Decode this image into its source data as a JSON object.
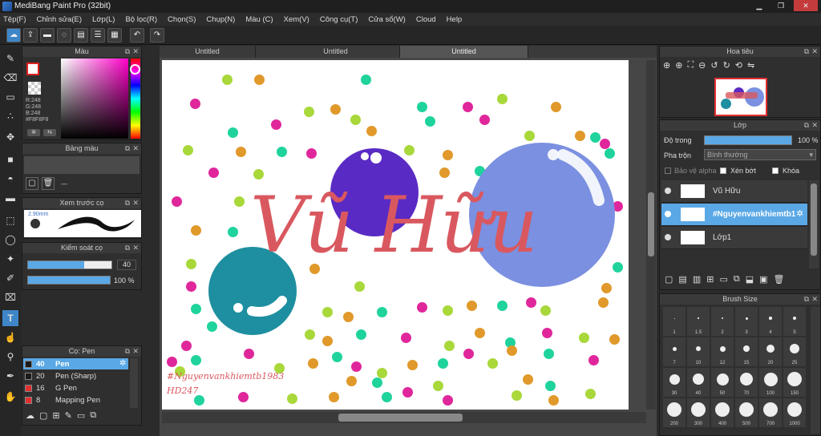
{
  "window": {
    "title": "MediBang Paint Pro (32bit)",
    "minimize": "▁",
    "restore": "❐",
    "close": "✕"
  },
  "menu": [
    "Tệp(F)",
    "Chỉnh sửa(E)",
    "Lớp(L)",
    "Bộ lọc(R)",
    "Chọn(S)",
    "Chụp(N)",
    "Màu (C)",
    "Xem(V)",
    "Công cụ(T)",
    "Cửa sổ(W)",
    "Cloud",
    "Help"
  ],
  "color_panel": {
    "title": "Màu",
    "r": "R:248",
    "g": "G:248",
    "b": "B:248",
    "hex": "#F8F8F8"
  },
  "palette_panel": {
    "title": "Bảng màu",
    "empty": "---"
  },
  "brush_preview": {
    "title": "Xem trước cọ",
    "size": "2.90mm"
  },
  "brush_control": {
    "title": "Kiểm soát cọ",
    "size_value": "40",
    "opacity_value": "100 %",
    "size_fill": 0.67,
    "opacity_fill": 1.0
  },
  "brush_list": {
    "title": "Cọ: Pen",
    "items": [
      {
        "size": "40",
        "name": "Pen",
        "selected": true,
        "color": "#1a1a1a"
      },
      {
        "size": "20",
        "name": "Pen (Sharp)",
        "selected": false,
        "color": "#1a1a1a"
      },
      {
        "size": "16",
        "name": "G Pen",
        "selected": false,
        "color": "#e03030"
      },
      {
        "size": "8",
        "name": "Mapping Pen",
        "selected": false,
        "color": "#e03030"
      }
    ]
  },
  "tabs": [
    "Untitled",
    "Untitled",
    "Untitled"
  ],
  "canvas": {
    "title_text": "Vũ Hữu",
    "signature_line1": "#Nguyenvankhiemtb1983",
    "signature_line2": "HD247"
  },
  "navigator": {
    "title": "Hoa tiêu"
  },
  "layer_panel": {
    "title": "Lớp",
    "opacity_label": "Độ trong",
    "opacity_value": "100 %",
    "blend_label": "Pha trộn",
    "blend_value": "Bình thường",
    "protect_alpha": "Bảo vệ alpha",
    "clipping": "Xén bớt",
    "lock": "Khóa",
    "layers": [
      {
        "name": "Vũ Hữu",
        "selected": false
      },
      {
        "name": "#Nguyenvankhiemtb1",
        "selected": true
      },
      {
        "name": "Lớp1",
        "selected": false
      }
    ]
  },
  "brush_size": {
    "title": "Brush Size",
    "rows": [
      [
        "1",
        "1.5",
        "2",
        "3",
        "4",
        "5"
      ],
      [
        "7",
        "10",
        "12",
        "15",
        "20",
        "25"
      ],
      [
        "30",
        "40",
        "50",
        "70",
        "100",
        "150"
      ],
      [
        "200",
        "300",
        "400",
        "500",
        "700",
        "1000"
      ]
    ]
  },
  "colors": {
    "pink_text": "#d9585f",
    "purple": "#5a2bc4",
    "blue": "#7a8fe0",
    "teal": "#1e8fa0",
    "accent": "#5aa8e6"
  }
}
